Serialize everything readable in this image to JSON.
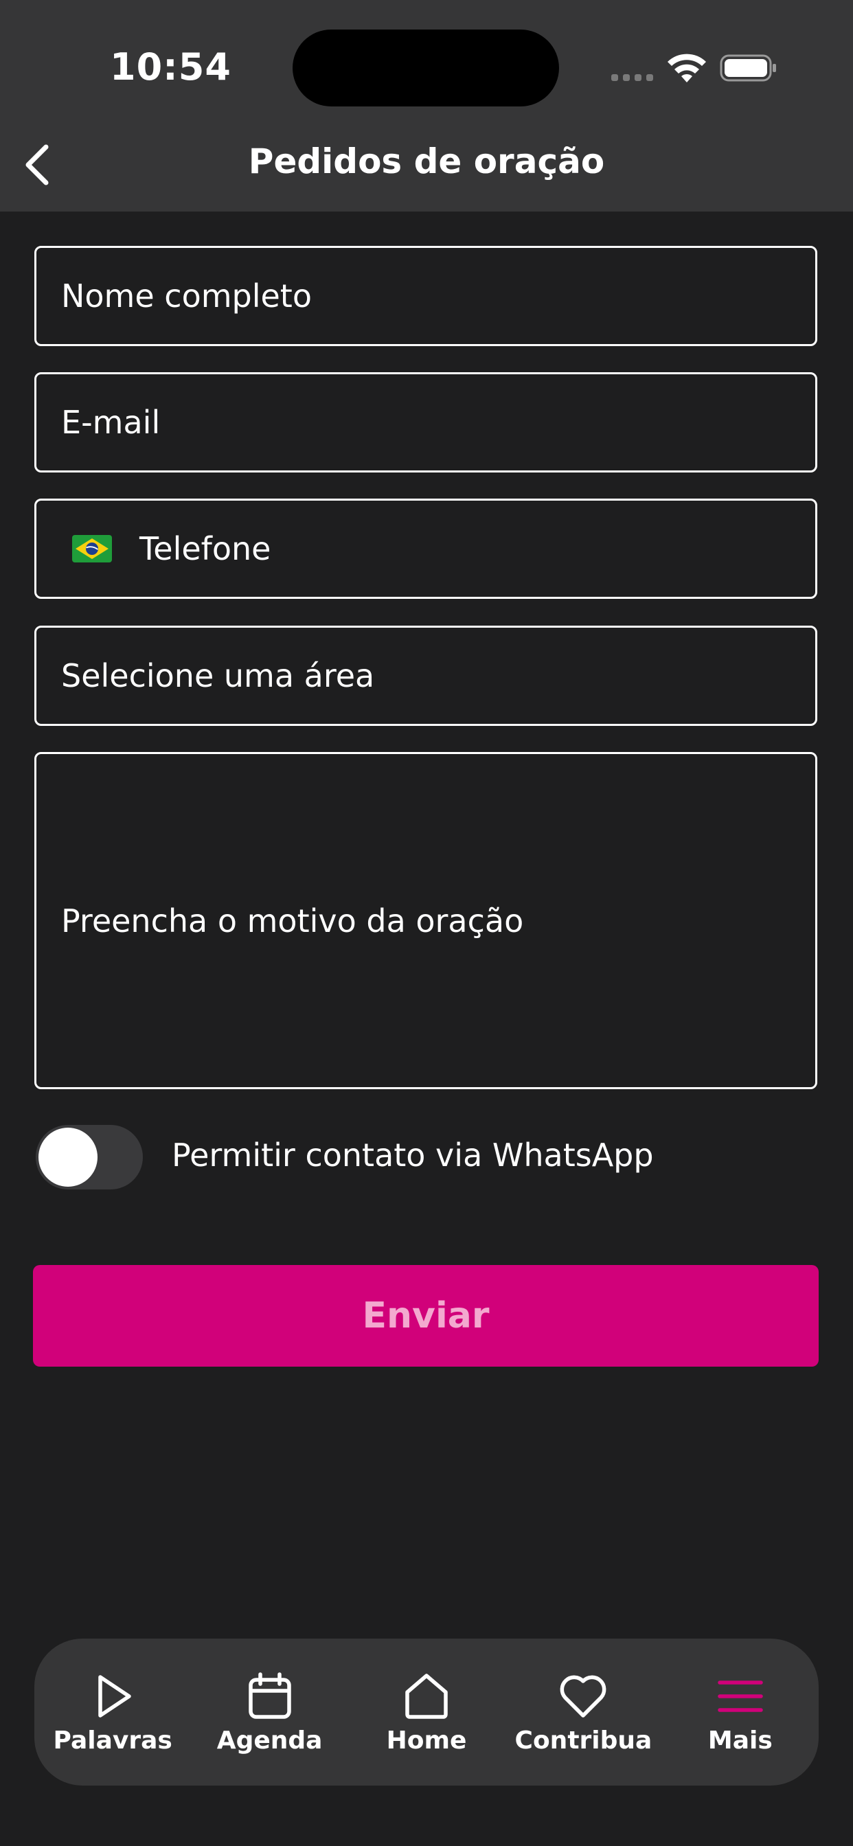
{
  "status_bar": {
    "time": "10:54"
  },
  "header": {
    "title": "Pedidos de oração",
    "back_icon": "chevron-left-icon"
  },
  "form": {
    "name_placeholder": "Nome completo",
    "email_placeholder": "E-mail",
    "phone_placeholder": "Telefone",
    "phone_country_icon": "brazil-flag-icon",
    "area_placeholder": "Selecione uma área",
    "reason_placeholder": "Preencha o motivo da oração",
    "whatsapp_toggle_label": "Permitir contato via WhatsApp",
    "whatsapp_toggle_on": false,
    "submit_label": "Enviar"
  },
  "bottom_nav": {
    "items": [
      {
        "label": "Palavras",
        "icon": "play-icon"
      },
      {
        "label": "Agenda",
        "icon": "calendar-icon"
      },
      {
        "label": "Home",
        "icon": "home-icon"
      },
      {
        "label": "Contribua",
        "icon": "heart-icon"
      },
      {
        "label": "Mais",
        "icon": "menu-icon"
      }
    ],
    "active_index": 4
  },
  "colors": {
    "background": "#1e1e1f",
    "header": "#363637",
    "accent": "#d1017a",
    "submit_text": "#f3a9cf"
  }
}
